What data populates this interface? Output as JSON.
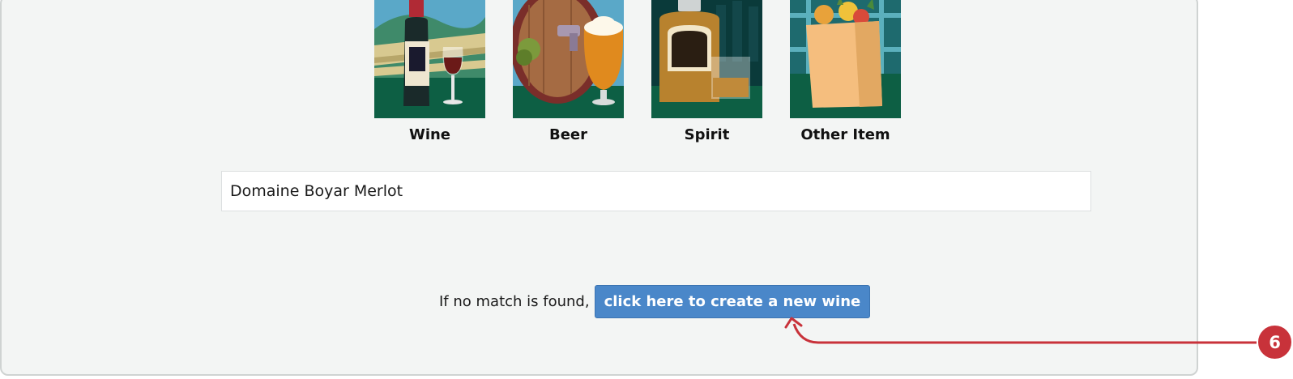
{
  "categories": [
    {
      "label": "Wine",
      "icon": "wine-bottle-glass-icon"
    },
    {
      "label": "Beer",
      "icon": "beer-barrel-glass-icon"
    },
    {
      "label": "Spirit",
      "icon": "spirit-bottle-glass-icon"
    },
    {
      "label": "Other Item",
      "icon": "grocery-bag-icon"
    }
  ],
  "search": {
    "value": "Domaine Boyar Merlot"
  },
  "no_match": {
    "prompt": "If no match is found,",
    "button_label": "click here to create a new wine"
  },
  "annotation": {
    "step_number": "6",
    "color": "#c8323a"
  },
  "colors": {
    "button": "#4a87c9",
    "panel_bg": "#f3f5f4",
    "art_green": "#0d5f44"
  }
}
